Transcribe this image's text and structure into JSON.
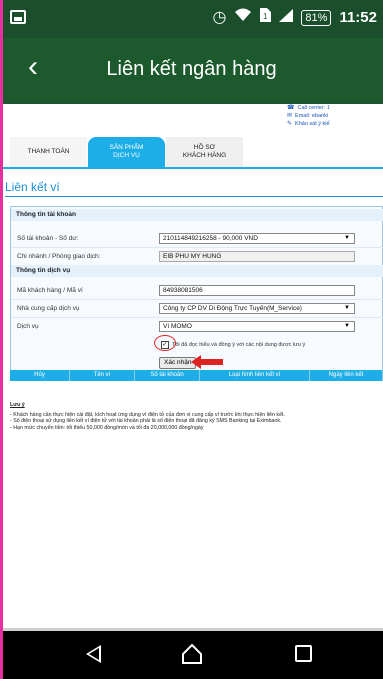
{
  "status_bar": {
    "battery": "81%",
    "time": "11:52",
    "icons": [
      "gallery-icon",
      "alarm-icon",
      "wifi-icon",
      "sim-icon",
      "signal-icon"
    ]
  },
  "app_bar": {
    "title": "Liên kết ngân hàng",
    "back_icon": "back-chevron-icon"
  },
  "contact": {
    "call_center": "Call center: 1",
    "email": "Email: ebanki",
    "feedback": "Khảo sát ý kiế"
  },
  "tabs": [
    {
      "label_line1": "THANH TOÁN",
      "label_line2": "",
      "active": false
    },
    {
      "label_line1": "SẢN PHẨM",
      "label_line2": "DỊCH VỤ",
      "active": true
    },
    {
      "label_line1": "HỒ SƠ",
      "label_line2": "KHÁCH HÀNG",
      "active": false
    }
  ],
  "section_title": "Liên kết ví",
  "form": {
    "account_header": "Thông tin tài khoản",
    "account_label": "Số tài khoản - Số dư:",
    "account_value": "210114849216258 - 90,000 VND",
    "branch_label": "Chi nhánh / Phòng giao dịch:",
    "branch_value": "EIB PHU MY HUNG",
    "service_header": "Thông tin dịch vụ",
    "customer_label": "Mã khách hàng / Mã ví",
    "customer_value": "84938081506",
    "provider_label": "Nhà cung cấp dịch vụ",
    "provider_value": "Công ty CP DV Di Động Trực Tuyến(M_Service)",
    "service_label": "Dịch vụ",
    "service_value": "Ví MOMO",
    "agree_text": "Tôi đã đọc hiểu và đồng ý với các nội dung được lưu ý",
    "agree_checked": true,
    "confirm_label": "Xác nhận"
  },
  "table_headers": [
    "Hủy",
    "Tên ví",
    "Số tài khoản",
    "Loại hình liên kết ví",
    "Ngày liên kết"
  ],
  "notes": {
    "title": "Lưu ý",
    "lines": [
      "- Khách hàng cần thực hiện cài đặt, kích hoạt ứng dụng ví điện tử của đơn vị cung cấp ví trước khi thực hiện liên kết.",
      "- Số điện thoại sử dụng liên kết ví điện tử với tài khoản phải là số điện thoại đã đăng ký SMS Banking tại Eximbank.",
      "- Hạn mức chuyển tiền: tối thiểu 50,000 đồng/món và tối đa 20,000,000 đồng/ngày"
    ]
  },
  "colors": {
    "app_bar": "#1c5a2e",
    "status_bar": "#1b4f2b",
    "tab_active": "#1daee8",
    "section_title": "#1a8fd6",
    "highlight": "#dd2222"
  }
}
